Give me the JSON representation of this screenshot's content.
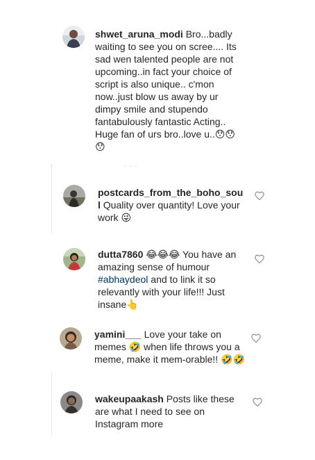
{
  "comments": [
    {
      "username": "shwet_aruna_modi",
      "text": "Bro...badly waiting to see you on scree.... Its sad wen talented people are not upcoming..in fact your choice of script is also unique.. c'mon now..just blow us away by ur dimpy smile and stupendo fantabulously fantastic Acting.. Huge fan of urs bro..love u..😯😯 😯"
    },
    {
      "username": "postcards_from_the_boho_soul",
      "text": "Quality over quantity! Love your work 😜"
    },
    {
      "username": "dutta7860",
      "text_before": "😂😂😂 You have an amazing sense of humour ",
      "hashtag": "#abhaydeol",
      "text_after": " and to link it so relevantly with your life!!! Just insane👆"
    },
    {
      "username": "yamini___",
      "text": "Love your take on memes 🤣 when life throws you a meme, make it mem-orable!! 🤣🤣"
    },
    {
      "username": "wakeupaakash",
      "text": "Posts like these are what I need to see on Instagram more"
    }
  ],
  "icons": {
    "like": "heart-outline-icon"
  },
  "colors": {
    "text": "#262626",
    "hashtag": "#003569",
    "heart": "#8e8e8e",
    "divider": "#e6e6e6"
  }
}
